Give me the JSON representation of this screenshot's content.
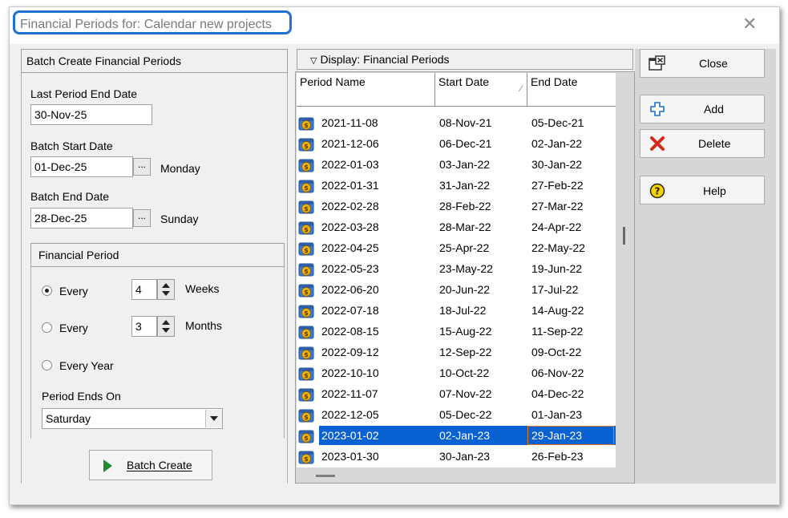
{
  "window": {
    "title": "Financial Periods for: Calendar new projects",
    "close_glyph": "✕"
  },
  "left": {
    "header": "Batch Create Financial Periods",
    "last_period_label": "Last Period End Date",
    "last_period_value": "30-Nov-25",
    "batch_start_label": "Batch Start Date",
    "batch_start_value": "01-Dec-25",
    "batch_start_day": "Monday",
    "batch_end_label": "Batch End Date",
    "batch_end_value": "28-Dec-25",
    "batch_end_day": "Sunday",
    "dots": "...",
    "financial_period": {
      "header": "Financial Period",
      "every_weeks_label": "Every",
      "weeks_value": "4",
      "weeks_unit": "Weeks",
      "every_months_label": "Every",
      "months_value": "3",
      "months_unit": "Months",
      "every_year_label": "Every Year",
      "period_ends_label": "Period Ends On",
      "period_ends_value": "Saturday"
    },
    "batch_create_label": "Batch Create"
  },
  "list": {
    "header": "Display: Financial Periods",
    "columns": [
      "Period Name",
      "Start Date",
      "End Date"
    ],
    "rows": [
      [
        "2021-11-08",
        "08-Nov-21",
        "05-Dec-21"
      ],
      [
        "2021-12-06",
        "06-Dec-21",
        "02-Jan-22"
      ],
      [
        "2022-01-03",
        "03-Jan-22",
        "30-Jan-22"
      ],
      [
        "2022-01-31",
        "31-Jan-22",
        "27-Feb-22"
      ],
      [
        "2022-02-28",
        "28-Feb-22",
        "27-Mar-22"
      ],
      [
        "2022-03-28",
        "28-Mar-22",
        "24-Apr-22"
      ],
      [
        "2022-04-25",
        "25-Apr-22",
        "22-May-22"
      ],
      [
        "2022-05-23",
        "23-May-22",
        "19-Jun-22"
      ],
      [
        "2022-06-20",
        "20-Jun-22",
        "17-Jul-22"
      ],
      [
        "2022-07-18",
        "18-Jul-22",
        "14-Aug-22"
      ],
      [
        "2022-08-15",
        "15-Aug-22",
        "11-Sep-22"
      ],
      [
        "2022-09-12",
        "12-Sep-22",
        "09-Oct-22"
      ],
      [
        "2022-10-10",
        "10-Oct-22",
        "06-Nov-22"
      ],
      [
        "2022-11-07",
        "07-Nov-22",
        "04-Dec-22"
      ],
      [
        "2022-12-05",
        "05-Dec-22",
        "01-Jan-23"
      ],
      [
        "2023-01-02",
        "02-Jan-23",
        "29-Jan-23"
      ],
      [
        "2023-01-30",
        "30-Jan-23",
        "26-Feb-23"
      ]
    ],
    "selected_index": 15
  },
  "buttons": {
    "close": "Close",
    "add": "Add",
    "delete": "Delete",
    "help": "Help"
  },
  "colors": {
    "accent": "#0a62d2",
    "title_outline": "#1e73d2",
    "delete_x": "#d42a1a",
    "help_icon": "#f3d400"
  }
}
